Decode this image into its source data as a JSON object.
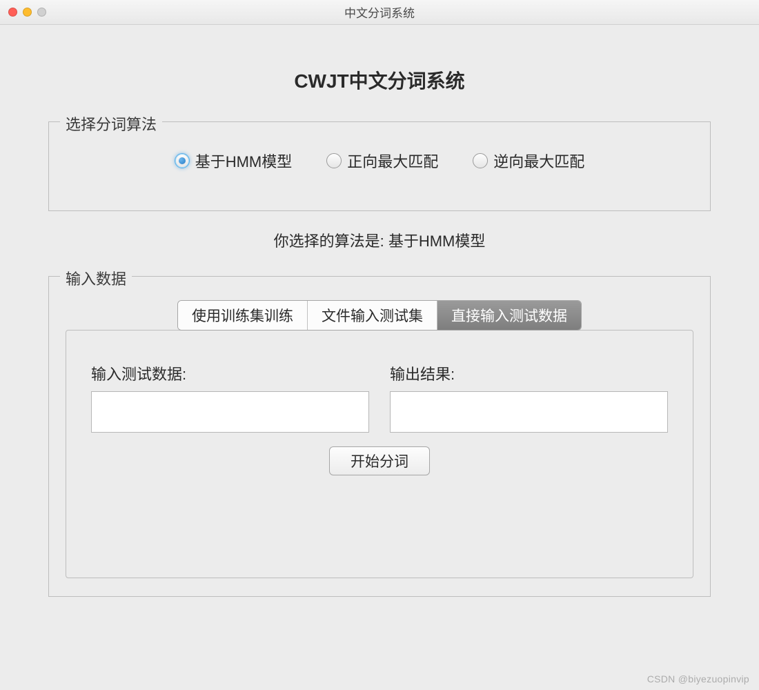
{
  "window_title": "中文分词系统",
  "page_title": "CWJT中文分词系统",
  "algorithm_group": {
    "legend": "选择分词算法",
    "options": [
      {
        "label": "基于HMM模型",
        "selected": true
      },
      {
        "label": "正向最大匹配",
        "selected": false
      },
      {
        "label": "逆向最大匹配",
        "selected": false
      }
    ]
  },
  "status_text": "你选择的算法是: 基于HMM模型",
  "input_group": {
    "legend": "输入数据",
    "tabs": [
      {
        "label": "使用训练集训练",
        "active": false
      },
      {
        "label": "文件输入测试集",
        "active": false
      },
      {
        "label": "直接输入测试数据",
        "active": true
      }
    ],
    "input_label": "输入测试数据:",
    "output_label": "输出结果:",
    "input_value": "",
    "output_value": "",
    "action_button": "开始分词"
  },
  "watermark": "CSDN @biyezuopinvip"
}
